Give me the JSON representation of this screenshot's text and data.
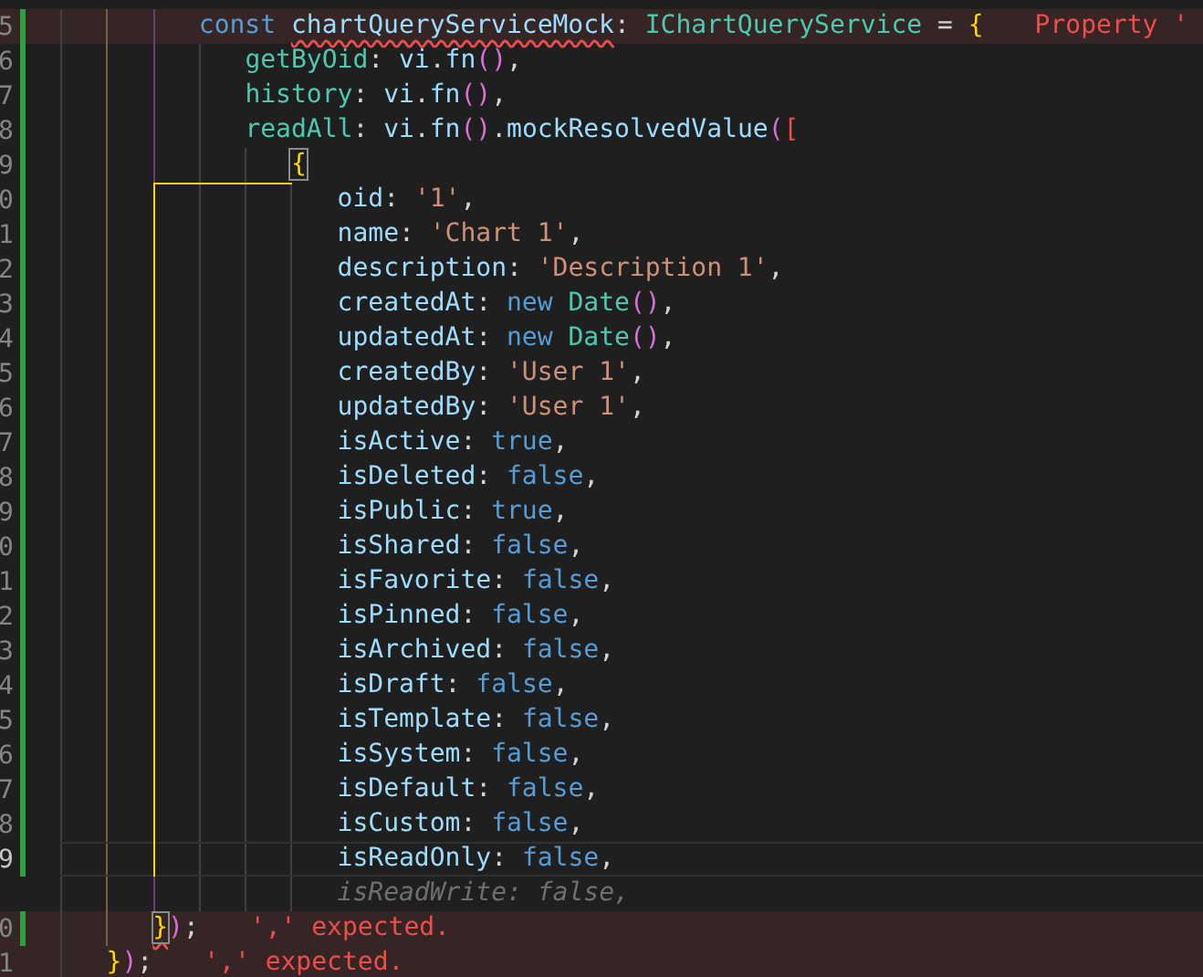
{
  "editor": {
    "lines": [
      {
        "kind": "group",
        "children": [
          {
            "kind": "group",
            "children": [
              {
                "number": "5",
                "kind": "code",
                "modified": true,
                "error": "Property '",
                "tokens": [
                  {
                    "kind": "kw",
                    "text": "const "
                  },
                  {
                    "kind": "var",
                    "text": "chartQueryServiceMock",
                    "squiggle": true
                  },
                  {
                    "kind": "punct",
                    "text": ": "
                  },
                  {
                    "kind": "type",
                    "text": "IChartQueryService"
                  },
                  {
                    "kind": "punct",
                    "text": " = "
                  },
                  {
                    "kind": "brace",
                    "text": "{"
                  }
                ],
                "children": [
                  {
                    "number": "6",
                    "kind": "code",
                    "modified": true,
                    "tokens": [
                      {
                        "kind": "method",
                        "text": "getByOid"
                      },
                      {
                        "kind": "punct",
                        "text": ": "
                      },
                      {
                        "kind": "var",
                        "text": "vi"
                      },
                      {
                        "kind": "punct",
                        "text": "."
                      },
                      {
                        "kind": "var",
                        "text": "fn"
                      },
                      {
                        "kind": "paren",
                        "text": "()"
                      },
                      {
                        "kind": "punct",
                        "text": ","
                      }
                    ]
                  },
                  {
                    "number": "7",
                    "kind": "code",
                    "modified": true,
                    "tokens": [
                      {
                        "kind": "method",
                        "text": "history"
                      },
                      {
                        "kind": "punct",
                        "text": ": "
                      },
                      {
                        "kind": "var",
                        "text": "vi"
                      },
                      {
                        "kind": "punct",
                        "text": "."
                      },
                      {
                        "kind": "var",
                        "text": "fn"
                      },
                      {
                        "kind": "paren",
                        "text": "()"
                      },
                      {
                        "kind": "punct",
                        "text": ","
                      }
                    ]
                  },
                  {
                    "number": "8",
                    "kind": "code",
                    "modified": true,
                    "tokens": [
                      {
                        "kind": "method",
                        "text": "readAll"
                      },
                      {
                        "kind": "punct",
                        "text": ": "
                      },
                      {
                        "kind": "var",
                        "text": "vi"
                      },
                      {
                        "kind": "punct",
                        "text": "."
                      },
                      {
                        "kind": "var",
                        "text": "fn"
                      },
                      {
                        "kind": "paren",
                        "text": "()"
                      },
                      {
                        "kind": "punct",
                        "text": "."
                      },
                      {
                        "kind": "var",
                        "text": "mockResolvedValue"
                      },
                      {
                        "kind": "paren",
                        "text": "("
                      },
                      {
                        "kind": "bracket",
                        "text": "["
                      }
                    ],
                    "children": [
                      {
                        "number": "9",
                        "kind": "code",
                        "modified": true,
                        "pair_guide": true,
                        "tokens": [
                          {
                            "kind": "brace",
                            "text": "{",
                            "matched": true
                          }
                        ],
                        "children": [
                          {
                            "number": "0",
                            "kind": "code",
                            "modified": true,
                            "tokens": [
                              {
                                "kind": "var",
                                "text": "oid"
                              },
                              {
                                "kind": "punct",
                                "text": ": "
                              },
                              {
                                "kind": "str",
                                "text": "'1'"
                              },
                              {
                                "kind": "punct",
                                "text": ","
                              }
                            ]
                          },
                          {
                            "number": "1",
                            "kind": "code",
                            "modified": true,
                            "tokens": [
                              {
                                "kind": "var",
                                "text": "name"
                              },
                              {
                                "kind": "punct",
                                "text": ": "
                              },
                              {
                                "kind": "str",
                                "text": "'Chart 1'"
                              },
                              {
                                "kind": "punct",
                                "text": ","
                              }
                            ]
                          },
                          {
                            "number": "2",
                            "kind": "code",
                            "modified": true,
                            "tokens": [
                              {
                                "kind": "var",
                                "text": "description"
                              },
                              {
                                "kind": "punct",
                                "text": ": "
                              },
                              {
                                "kind": "str",
                                "text": "'Description 1'"
                              },
                              {
                                "kind": "punct",
                                "text": ","
                              }
                            ]
                          },
                          {
                            "number": "3",
                            "kind": "code",
                            "modified": true,
                            "tokens": [
                              {
                                "kind": "var",
                                "text": "createdAt"
                              },
                              {
                                "kind": "punct",
                                "text": ": "
                              },
                              {
                                "kind": "kw",
                                "text": "new "
                              },
                              {
                                "kind": "type",
                                "text": "Date"
                              },
                              {
                                "kind": "paren",
                                "text": "()"
                              },
                              {
                                "kind": "punct",
                                "text": ","
                              }
                            ]
                          },
                          {
                            "number": "4",
                            "kind": "code",
                            "modified": true,
                            "tokens": [
                              {
                                "kind": "var",
                                "text": "updatedAt"
                              },
                              {
                                "kind": "punct",
                                "text": ": "
                              },
                              {
                                "kind": "kw",
                                "text": "new "
                              },
                              {
                                "kind": "type",
                                "text": "Date"
                              },
                              {
                                "kind": "paren",
                                "text": "()"
                              },
                              {
                                "kind": "punct",
                                "text": ","
                              }
                            ]
                          },
                          {
                            "number": "5",
                            "kind": "code",
                            "modified": true,
                            "tokens": [
                              {
                                "kind": "var",
                                "text": "createdBy"
                              },
                              {
                                "kind": "punct",
                                "text": ": "
                              },
                              {
                                "kind": "str",
                                "text": "'User 1'"
                              },
                              {
                                "kind": "punct",
                                "text": ","
                              }
                            ]
                          },
                          {
                            "number": "6",
                            "kind": "code",
                            "modified": true,
                            "tokens": [
                              {
                                "kind": "var",
                                "text": "updatedBy"
                              },
                              {
                                "kind": "punct",
                                "text": ": "
                              },
                              {
                                "kind": "str",
                                "text": "'User 1'"
                              },
                              {
                                "kind": "punct",
                                "text": ","
                              }
                            ]
                          },
                          {
                            "number": "7",
                            "kind": "code",
                            "modified": true,
                            "tokens": [
                              {
                                "kind": "var",
                                "text": "isActive"
                              },
                              {
                                "kind": "punct",
                                "text": ": "
                              },
                              {
                                "kind": "kw",
                                "text": "true"
                              },
                              {
                                "kind": "punct",
                                "text": ","
                              }
                            ]
                          },
                          {
                            "number": "8",
                            "kind": "code",
                            "modified": true,
                            "tokens": [
                              {
                                "kind": "var",
                                "text": "isDeleted"
                              },
                              {
                                "kind": "punct",
                                "text": ": "
                              },
                              {
                                "kind": "kw",
                                "text": "false"
                              },
                              {
                                "kind": "punct",
                                "text": ","
                              }
                            ]
                          },
                          {
                            "number": "9",
                            "kind": "code",
                            "modified": true,
                            "tokens": [
                              {
                                "kind": "var",
                                "text": "isPublic"
                              },
                              {
                                "kind": "punct",
                                "text": ": "
                              },
                              {
                                "kind": "kw",
                                "text": "true"
                              },
                              {
                                "kind": "punct",
                                "text": ","
                              }
                            ]
                          },
                          {
                            "number": "0",
                            "kind": "code",
                            "modified": true,
                            "tokens": [
                              {
                                "kind": "var",
                                "text": "isShared"
                              },
                              {
                                "kind": "punct",
                                "text": ": "
                              },
                              {
                                "kind": "kw",
                                "text": "false"
                              },
                              {
                                "kind": "punct",
                                "text": ","
                              }
                            ]
                          },
                          {
                            "number": "1",
                            "kind": "code",
                            "modified": true,
                            "tokens": [
                              {
                                "kind": "var",
                                "text": "isFavorite"
                              },
                              {
                                "kind": "punct",
                                "text": ": "
                              },
                              {
                                "kind": "kw",
                                "text": "false"
                              },
                              {
                                "kind": "punct",
                                "text": ","
                              }
                            ]
                          },
                          {
                            "number": "2",
                            "kind": "code",
                            "modified": true,
                            "tokens": [
                              {
                                "kind": "var",
                                "text": "isPinned"
                              },
                              {
                                "kind": "punct",
                                "text": ": "
                              },
                              {
                                "kind": "kw",
                                "text": "false"
                              },
                              {
                                "kind": "punct",
                                "text": ","
                              }
                            ]
                          },
                          {
                            "number": "3",
                            "kind": "code",
                            "modified": true,
                            "tokens": [
                              {
                                "kind": "var",
                                "text": "isArchived"
                              },
                              {
                                "kind": "punct",
                                "text": ": "
                              },
                              {
                                "kind": "kw",
                                "text": "false"
                              },
                              {
                                "kind": "punct",
                                "text": ","
                              }
                            ]
                          },
                          {
                            "number": "4",
                            "kind": "code",
                            "modified": true,
                            "tokens": [
                              {
                                "kind": "var",
                                "text": "isDraft"
                              },
                              {
                                "kind": "punct",
                                "text": ": "
                              },
                              {
                                "kind": "kw",
                                "text": "false"
                              },
                              {
                                "kind": "punct",
                                "text": ","
                              }
                            ]
                          },
                          {
                            "number": "5",
                            "kind": "code",
                            "modified": true,
                            "tokens": [
                              {
                                "kind": "var",
                                "text": "isTemplate"
                              },
                              {
                                "kind": "punct",
                                "text": ": "
                              },
                              {
                                "kind": "kw",
                                "text": "false"
                              },
                              {
                                "kind": "punct",
                                "text": ","
                              }
                            ]
                          },
                          {
                            "number": "6",
                            "kind": "code",
                            "modified": true,
                            "tokens": [
                              {
                                "kind": "var",
                                "text": "isSystem"
                              },
                              {
                                "kind": "punct",
                                "text": ": "
                              },
                              {
                                "kind": "kw",
                                "text": "false"
                              },
                              {
                                "kind": "punct",
                                "text": ","
                              }
                            ]
                          },
                          {
                            "number": "7",
                            "kind": "code",
                            "modified": true,
                            "tokens": [
                              {
                                "kind": "var",
                                "text": "isDefault"
                              },
                              {
                                "kind": "punct",
                                "text": ": "
                              },
                              {
                                "kind": "kw",
                                "text": "false"
                              },
                              {
                                "kind": "punct",
                                "text": ","
                              }
                            ]
                          },
                          {
                            "number": "8",
                            "kind": "code",
                            "modified": true,
                            "tokens": [
                              {
                                "kind": "var",
                                "text": "isCustom"
                              },
                              {
                                "kind": "punct",
                                "text": ": "
                              },
                              {
                                "kind": "kw",
                                "text": "false"
                              },
                              {
                                "kind": "punct",
                                "text": ","
                              }
                            ]
                          },
                          {
                            "number": "9",
                            "kind": "code",
                            "modified": true,
                            "current": true,
                            "tokens": [
                              {
                                "kind": "var",
                                "text": "isReadOnly"
                              },
                              {
                                "kind": "punct",
                                "text": ": "
                              },
                              {
                                "kind": "kw",
                                "text": "false"
                              },
                              {
                                "kind": "punct",
                                "text": ","
                              }
                            ]
                          },
                          {
                            "kind": "ghost",
                            "text": "isReadWrite: false,"
                          }
                        ]
                      }
                    ]
                  }
                ]
              }
            ]
          },
          {
            "number": "0",
            "kind": "code",
            "modified": true,
            "error": "',' expected.",
            "tokens": [
              {
                "kind": "brace",
                "text": "}",
                "matched": true,
                "squiggle": true
              },
              {
                "kind": "paren",
                "text": ")"
              },
              {
                "kind": "punct",
                "text": ";"
              }
            ]
          }
        ]
      },
      {
        "number": "1",
        "kind": "code",
        "modified": false,
        "error": "',' expected.",
        "tokens": [
          {
            "kind": "brace",
            "text": "}"
          },
          {
            "kind": "paren",
            "text": ")"
          },
          {
            "kind": "punct",
            "text": ";"
          }
        ]
      }
    ]
  }
}
